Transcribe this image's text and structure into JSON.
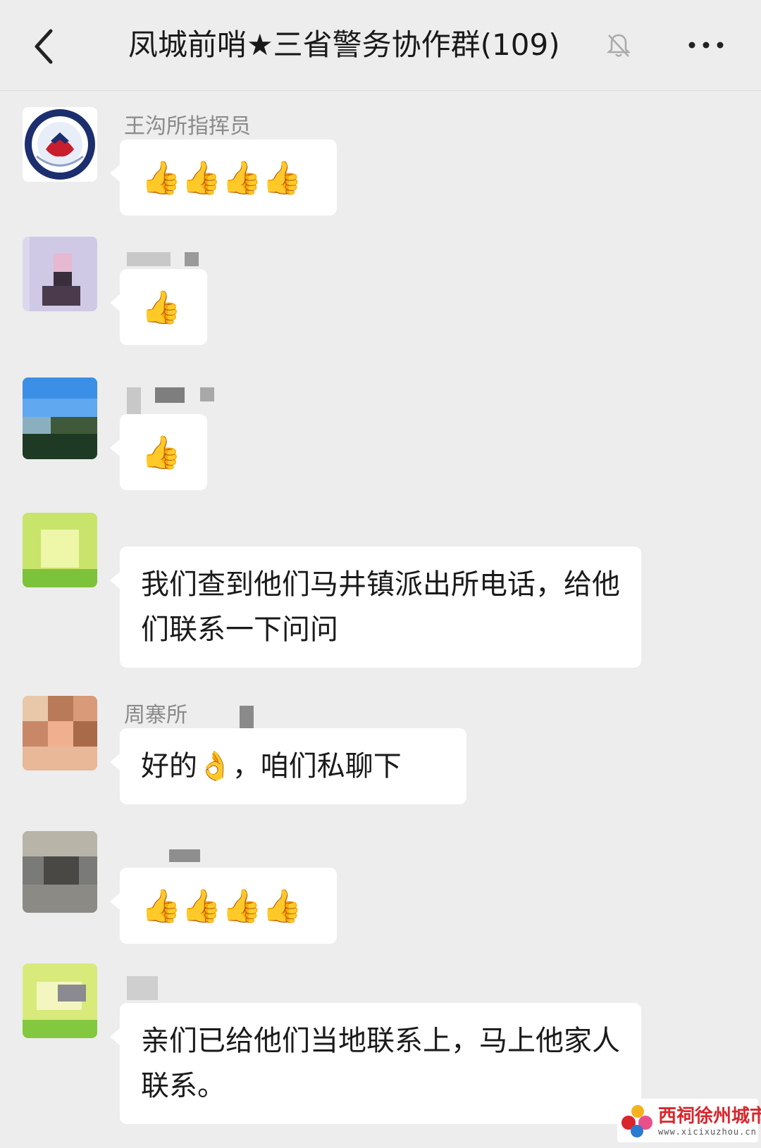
{
  "header": {
    "title": "凤城前哨★三省警务协作群(109)"
  },
  "messages": [
    {
      "sender": "王沟所指挥员",
      "text": "",
      "emoji": "👍👍👍👍"
    },
    {
      "sender": "",
      "text": "",
      "emoji": "👍"
    },
    {
      "sender": "",
      "text": "",
      "emoji": "👍"
    },
    {
      "sender": "",
      "text": "我们查到他们马井镇派出所电话，给他们联系一下问问"
    },
    {
      "sender": "周寨所",
      "text": "好的👌，咱们私聊下"
    },
    {
      "sender": "",
      "text": "",
      "emoji": "👍👍👍👍"
    },
    {
      "sender": "",
      "text": "亲们已给他们当地联系上，马上他家人联系。"
    }
  ],
  "watermark": {
    "title": "西祠徐州城市站",
    "url": "www.xicixuzhou.cn"
  },
  "colors": {
    "background": "#ededed",
    "bubble": "#ffffff",
    "sender": "#8a8a8a"
  }
}
